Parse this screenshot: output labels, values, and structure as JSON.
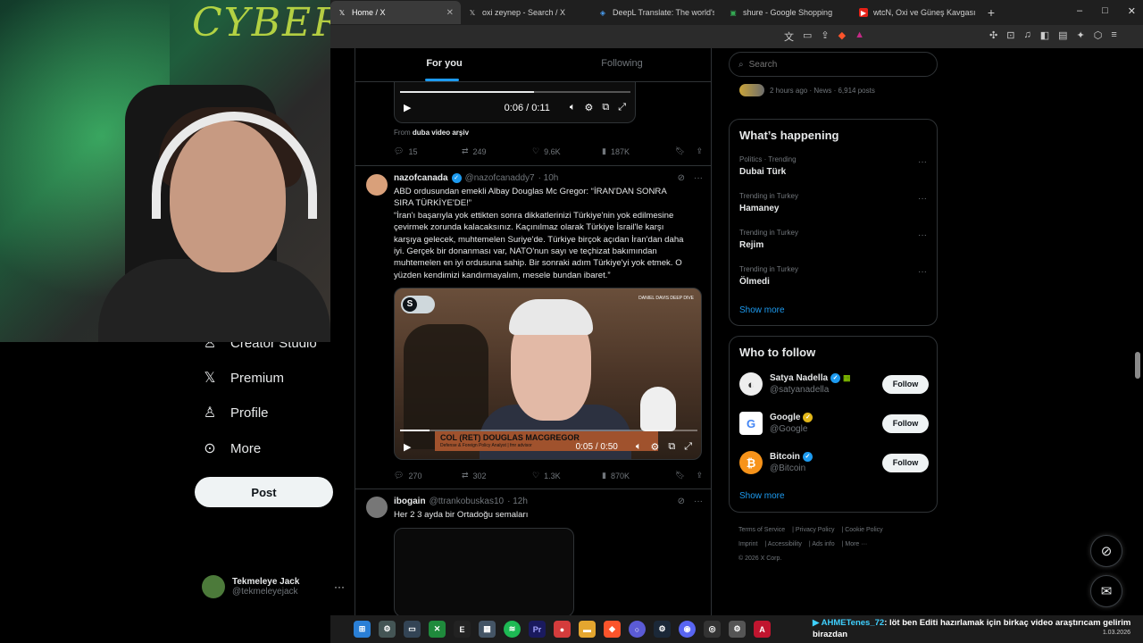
{
  "browser": {
    "tabs": [
      {
        "title": "Home / X",
        "favicon": "x-logo",
        "active": true
      },
      {
        "title": "oxi zeynep - Search / X",
        "favicon": "x-logo",
        "active": false
      },
      {
        "title": "DeepL Translate: The world's m",
        "favicon": "deepl-icon",
        "active": false
      },
      {
        "title": "shure - Google Shopping",
        "favicon": "google-shopping-icon",
        "active": false
      },
      {
        "title": "wtcN, Oxi ve Güneş Kavgası Vi",
        "favicon": "youtube-icon",
        "active": false
      }
    ],
    "new_tab": "+",
    "window_controls": [
      "–",
      "□",
      "✕"
    ]
  },
  "webcam": {
    "brand_text": "CYBERPU"
  },
  "leftnav": {
    "items": [
      {
        "label": "Creator Studio",
        "icon": "creator-studio-icon"
      },
      {
        "label": "Premium",
        "icon": "x-logo-icon"
      },
      {
        "label": "Profile",
        "icon": "person-icon"
      },
      {
        "label": "More",
        "icon": "more-circle-icon"
      }
    ],
    "post_label": "Post",
    "account": {
      "name": "Tekmeleye Jack",
      "handle": "@tekmeleyejack"
    }
  },
  "timeline": {
    "tabs": [
      {
        "label": "For you",
        "active": true
      },
      {
        "label": "Following",
        "active": false
      }
    ],
    "tweet1": {
      "video_time": "0:06 / 0:11",
      "video_progress": 0.58,
      "from_prefix": "From",
      "from_source": "duba video arşiv",
      "replies": "15",
      "reposts": "249",
      "likes": "9.6K",
      "views": "187K"
    },
    "tweet2": {
      "name": "nazofcanada",
      "handle": "@nazofcanaddy7",
      "time": "· 10h",
      "text_lines": [
        "ABD ordusundan emekli Albay Douglas Mc Gregor: “İRAN'DAN SONRA",
        "SIRA TÜRKİYE'DE!”",
        "“İran'ı başarıyla yok ettikten sonra dikkatlerinizi Türkiye'nin yok edilmesine",
        "çevirmek zorunda kalacaksınız. Kaçınılmaz olarak Türkiye İsrail'le karşı",
        "karşıya gelecek, muhtemelen Suriye'de. Türkiye birçok açıdan İran'dan daha",
        "iyi. Gerçek bir donanması var, NATO'nun sayı ve teçhizat bakımından",
        "muhtemelen en iyi ordusuna sahip. Bir sonraki adım Türkiye'yi yok etmek. O",
        "yüzden kendimizi kandırmayalım, mesele bundan ibaret.”"
      ],
      "video": {
        "badge": "S",
        "channel_logo": "DANIEL DAVIS DEEP DIVE",
        "lower_third_name": "COL (RET) DOUGLAS MACGREGOR",
        "lower_third_title": "Defense & Foreign Policy Analyst | fmr advisor",
        "time": "0:05 / 0:50",
        "progress": 0.1
      },
      "replies": "270",
      "reposts": "302",
      "likes": "1.3K",
      "views": "870K"
    },
    "tweet3": {
      "name": "ibogain",
      "handle": "@ttrankobuskas10",
      "time": "· 12h",
      "text": "Her 2 3 ayda bir Ortadoğu semaları"
    }
  },
  "right": {
    "search_placeholder": "Search",
    "news_meta": "2 hours ago · News · 6,914 posts",
    "happening_title": "What’s happening",
    "trends": [
      {
        "context": "Politics · Trending",
        "name": "Dubai Türk"
      },
      {
        "context": "Trending in Turkey",
        "name": "Hamaney"
      },
      {
        "context": "Trending in Turkey",
        "name": "Rejim"
      },
      {
        "context": "Trending in Turkey",
        "name": "Ölmedi"
      }
    ],
    "show_more": "Show more",
    "wtf_title": "Who to follow",
    "follow_label": "Follow",
    "who_to_follow": [
      {
        "name": "Satya Nadella",
        "handle": "@satyanadella",
        "badge": "blue"
      },
      {
        "name": "Google",
        "handle": "@Google",
        "badge": "gold"
      },
      {
        "name": "Bitcoin",
        "handle": "@Bitcoin",
        "badge": "blue"
      }
    ],
    "footer_links": [
      "Terms of Service",
      "Privacy Policy",
      "Cookie Policy",
      "Imprint",
      "Accessibility",
      "Ads info",
      "More ···"
    ],
    "copyright": "© 2026 X Corp."
  },
  "taskbar": {
    "chat_user": "AHMETenes_72",
    "chat_message": ": löt ben Editi hazırlamak için birkaç video araştırıcam gelirim birazdan",
    "date": "1.03.2026"
  }
}
